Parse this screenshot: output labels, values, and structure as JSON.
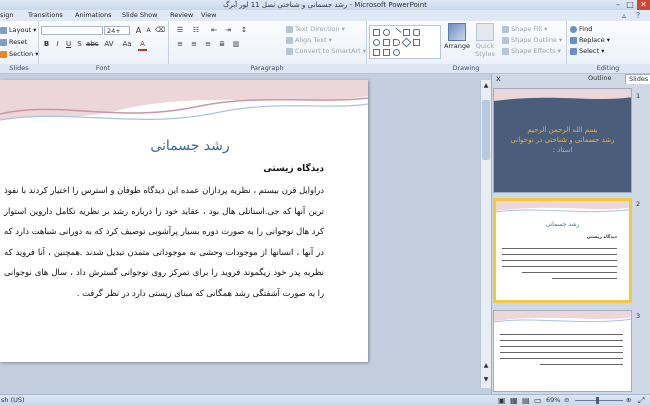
{
  "window": {
    "title": "رشد جسمانی و شناختی نصل 11 لور آبرگ - Microsoft PowerPoint"
  },
  "tabs": [
    "sign",
    "Transitions",
    "Animations",
    "Slide Show",
    "Review",
    "View"
  ],
  "ribbon": {
    "slides": {
      "label": "Slides",
      "layout": "Layout",
      "reset": "Reset",
      "section": "Section"
    },
    "font": {
      "label": "Font",
      "size": "24+",
      "grow": "A",
      "shrink": "A",
      "bold": "S",
      "spacing": "AV",
      "case": "Aa",
      "color": "A"
    },
    "paragraph": {
      "label": "Paragraph",
      "text_direction": "Text Direction",
      "align_text": "Align Text",
      "smartart": "Convert to SmartArt"
    },
    "drawing": {
      "label": "Drawing",
      "arrange": "Arrange",
      "quick_styles": "Quick Styles",
      "shape_fill": "Shape Fill",
      "shape_outline": "Shape Outline",
      "shape_effects": "Shape Effects"
    },
    "editing": {
      "label": "Editing",
      "find": "Find",
      "replace": "Replace",
      "select": "Select"
    }
  },
  "slide": {
    "title": "رشد جسمانی",
    "subtitle": "دیدگاه زیستی",
    "body": "دراوایل قرن بیستم ، نظریه پردازان عمده این دیدگاه طوفان و استرس را اختیار کردند با نفوذ ترین آنها که جی.استانلی هال بود ، عقاید خود را درباره رشد بر نظریه تکامل داروین استوار کرد هال نوجوانی را به صورت دوره بسیار پرآشوبی توصیف کرد که به دورانی شباهت دارد که در آنها ، انسانها از موجودات وحشی به موجوداتی متمدن تبدیل شدند .همچنین ، آنا فروید که نظریه پدر خود زیگموند فروید را برای تمرکز روی نوجوانی گسترش داد ، سال های نوجوانی را به صورت آشفتگی رشد همگانی که مبنای زیستی دارد در نظر گرفت ."
  },
  "panel": {
    "tabs": {
      "outline": "Outline",
      "slides": "Slides"
    },
    "close": "x",
    "thumbs": [
      {
        "num": "1",
        "lines": [
          "بسم الله الرحمن الرحیم",
          "رشد جسمانی و شناختی در نوجوانی",
          "استاد :"
        ]
      },
      {
        "num": "2",
        "title": "رشد جسمانی",
        "subtitle": "دیدگاه زیستی"
      },
      {
        "num": "3"
      }
    ]
  },
  "status": {
    "left": "sh (US)",
    "zoom": "69%"
  },
  "colors": {
    "accent": "#3a6b8c",
    "thumb1_bg": "#4a5d7a",
    "thumb1_text": "#e8b040",
    "selected": "#f5c842"
  }
}
